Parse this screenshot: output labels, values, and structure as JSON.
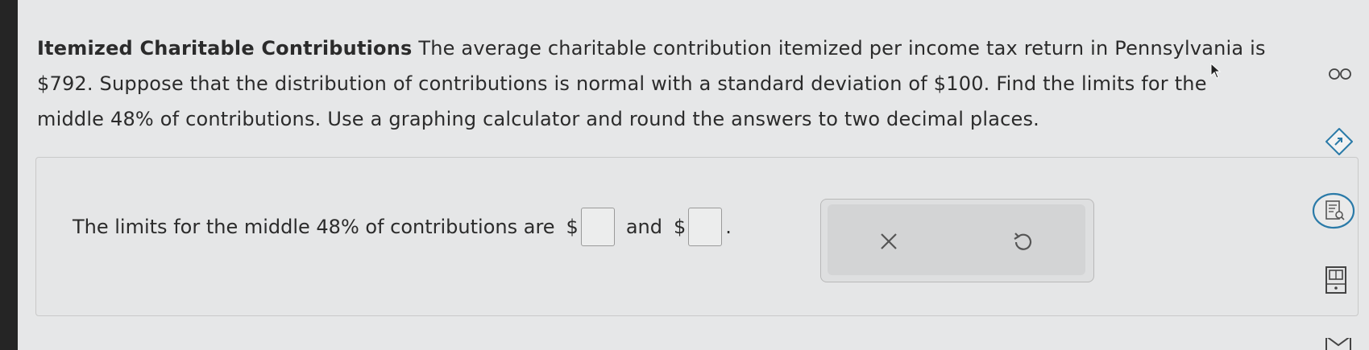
{
  "problem": {
    "title": "Itemized Charitable Contributions",
    "line1_rest": " The average charitable contribution itemized per income tax return in Pennsylvania is",
    "line2": "$792. Suppose that the distribution of contributions is normal with a standard deviation of $100. Find the limits for the",
    "line3": "middle 48% of contributions. Use a graphing calculator and round the answers to two decimal places."
  },
  "answer": {
    "prefix": "The limits for the middle 48% of contributions are",
    "dollar1": "$",
    "connector": "and",
    "dollar2": "$",
    "period": ".",
    "value1": "",
    "value2": ""
  },
  "tools": {
    "clear_icon": "x-icon",
    "reset_icon": "undo-icon"
  },
  "sidebar": {
    "icons": [
      "infinity-icon",
      "arrow-diamond-icon",
      "document-search-icon",
      "calculator-icon",
      "mail-icon"
    ]
  },
  "colors": {
    "accent": "#2a7aa8",
    "background": "#e6e7e8"
  }
}
